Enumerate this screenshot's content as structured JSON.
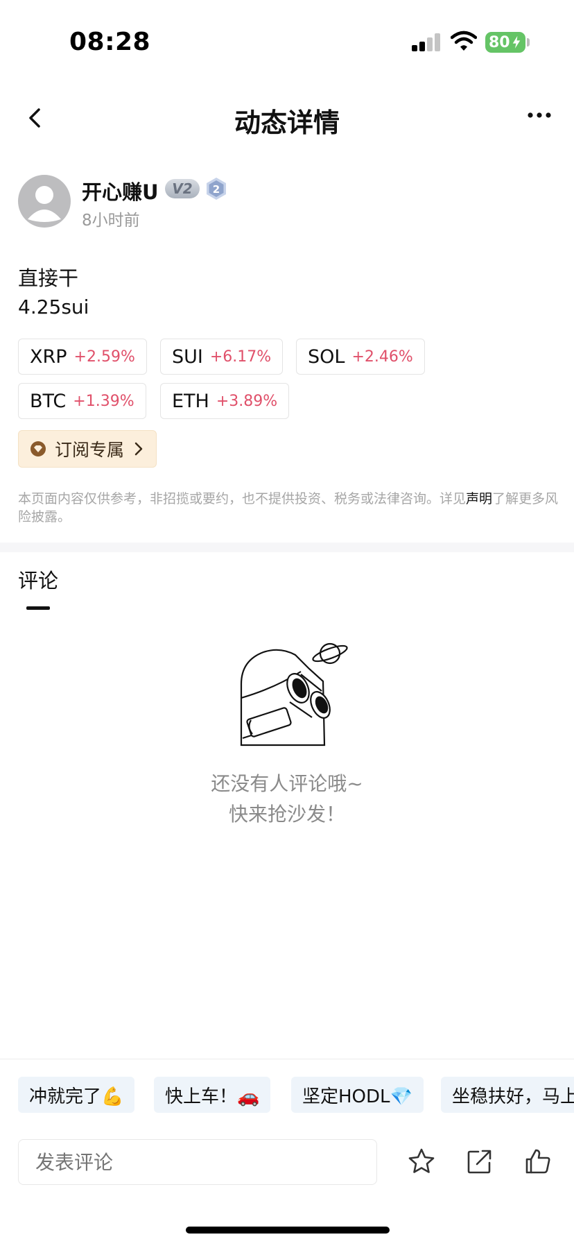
{
  "status_bar": {
    "time": "08:28",
    "battery": "80"
  },
  "nav": {
    "title": "动态详情"
  },
  "author": {
    "name": "开心赚U",
    "vip_badge": "V2",
    "level_badge": "2",
    "time_ago": "8小时前"
  },
  "post": {
    "line1": "直接干",
    "line2": "4.25sui"
  },
  "tags": [
    {
      "symbol": "XRP",
      "change": "+2.59%"
    },
    {
      "symbol": "SUI",
      "change": "+6.17%"
    },
    {
      "symbol": "SOL",
      "change": "+2.46%"
    },
    {
      "symbol": "BTC",
      "change": "+1.39%"
    },
    {
      "symbol": "ETH",
      "change": "+3.89%"
    }
  ],
  "subscribe": {
    "label": "订阅专属"
  },
  "disclaimer": {
    "text": "本页面内容仅供参考，非招揽或要约，也不提供投资、税务或法律咨询。详见",
    "link": "声明",
    "text2": "了解更多风险披露。"
  },
  "comments": {
    "title": "评论",
    "empty_line1": "还没有人评论哦~",
    "empty_line2": "快来抢沙发！"
  },
  "quick_replies": [
    {
      "text": "冲就完了💪"
    },
    {
      "text": "快上车！🚗"
    },
    {
      "text": "坚定HODL💎"
    },
    {
      "text": "坐稳扶好，马上"
    }
  ],
  "comment_box": {
    "placeholder": "发表评论"
  },
  "colors": {
    "up": "#e0506a",
    "battery": "#65c466",
    "chip_bg": "#eef4fa",
    "subscribe_bg": "#fcefdc"
  },
  "icons": [
    "back-icon",
    "more-icon",
    "avatar-icon",
    "level-badge-icon",
    "diamond-icon",
    "chevron-right-icon",
    "star-icon",
    "share-icon",
    "thumbs-up-icon"
  ]
}
